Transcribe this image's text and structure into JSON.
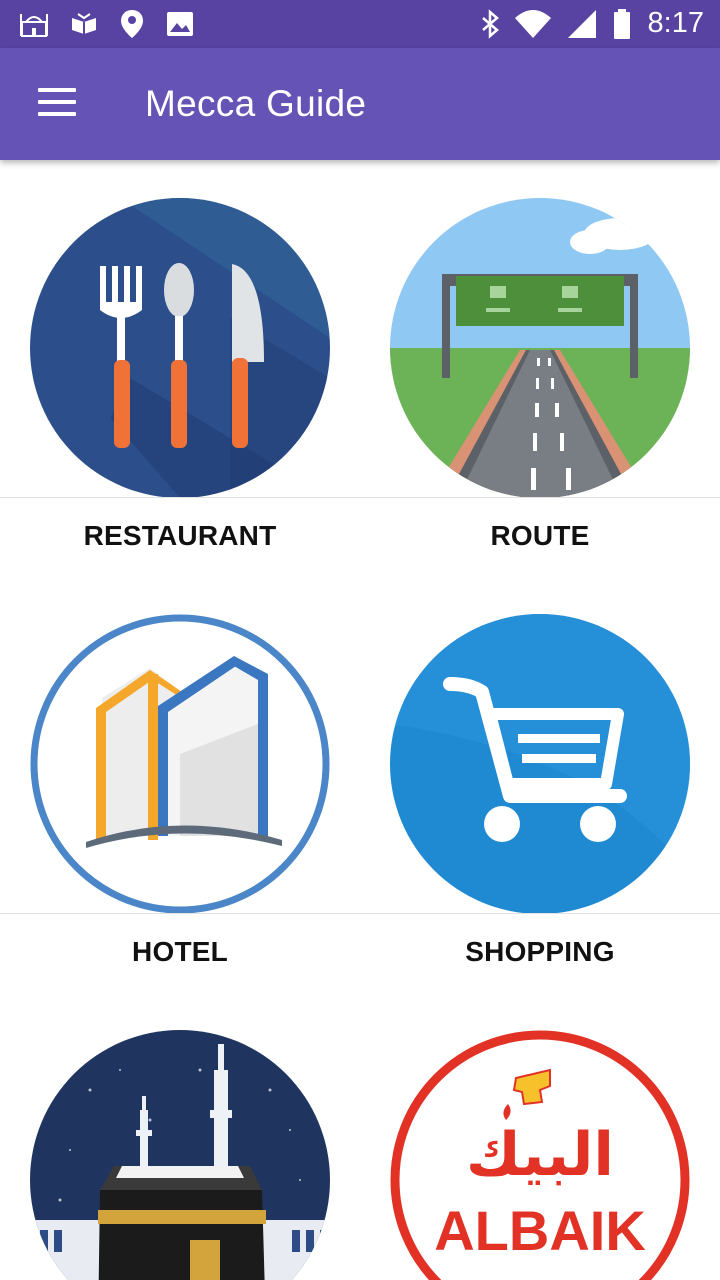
{
  "status_bar": {
    "time": "8:17",
    "left_icons": [
      "mosque-notification-icon",
      "quran-notification-icon",
      "location-icon",
      "image-icon"
    ],
    "right_icons": [
      "bluetooth-icon",
      "wifi-icon",
      "signal-icon",
      "battery-icon"
    ]
  },
  "app_bar": {
    "title": "Mecca Guide",
    "menu_icon": "menu-icon",
    "color": "#6554b5"
  },
  "tiles": [
    {
      "label": "RESTAURANT",
      "icon": "cutlery-icon"
    },
    {
      "label": "ROUTE",
      "icon": "road-icon"
    },
    {
      "label": "HOTEL",
      "icon": "building-icon"
    },
    {
      "label": "SHOPPING",
      "icon": "shopping-cart-icon"
    },
    {
      "label": "",
      "icon": "kaaba-icon"
    },
    {
      "label": "",
      "icon": "albaik-logo",
      "logo_text": "ALBAIK",
      "logo_arabic": "البيك"
    }
  ]
}
